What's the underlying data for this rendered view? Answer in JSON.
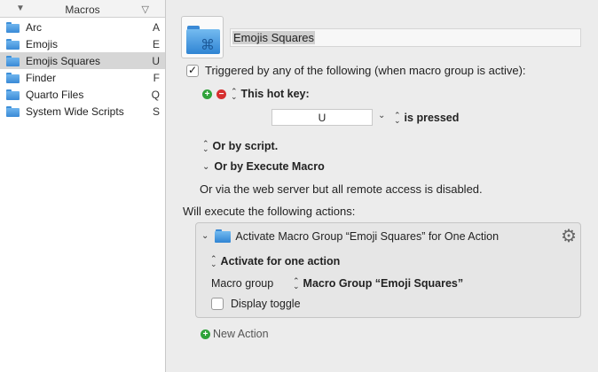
{
  "sidebar": {
    "title": "Macros",
    "items": [
      {
        "name": "Arc",
        "key": "A",
        "selected": false
      },
      {
        "name": "Emojis",
        "key": "E",
        "selected": false
      },
      {
        "name": "Emojis Squares",
        "key": "U",
        "selected": true
      },
      {
        "name": "Finder",
        "key": "F",
        "selected": false
      },
      {
        "name": "Quarto Files",
        "key": "Q",
        "selected": false
      },
      {
        "name": "System Wide Scripts",
        "key": "S",
        "selected": false
      }
    ]
  },
  "group": {
    "name": "Emojis Squares",
    "triggered_label": "Triggered by any of the following (when macro group is active):",
    "triggered_checked": true,
    "hotkey_label": "This hot key:",
    "hotkey_value": "U",
    "hotkey_state": "is pressed",
    "or_script": "Or by script.",
    "or_execute": "Or by Execute Macro",
    "webserver_note": "Or via the web server but all remote access is disabled.",
    "will_execute": "Will execute the following actions:"
  },
  "action": {
    "title": "Activate Macro Group “Emoji Squares” for One Action",
    "mode": "Activate for one action",
    "group_label": "Macro group",
    "group_value": "Macro Group “Emoji Squares”",
    "toggle_label": "Display toggle",
    "toggle_checked": false
  },
  "new_action_label": "New Action",
  "colors": {
    "accent_blue": "#3a8ad6",
    "add_green": "#2fa33a",
    "remove_red": "#d62f2f",
    "selected_row": "#d6d6d6"
  }
}
